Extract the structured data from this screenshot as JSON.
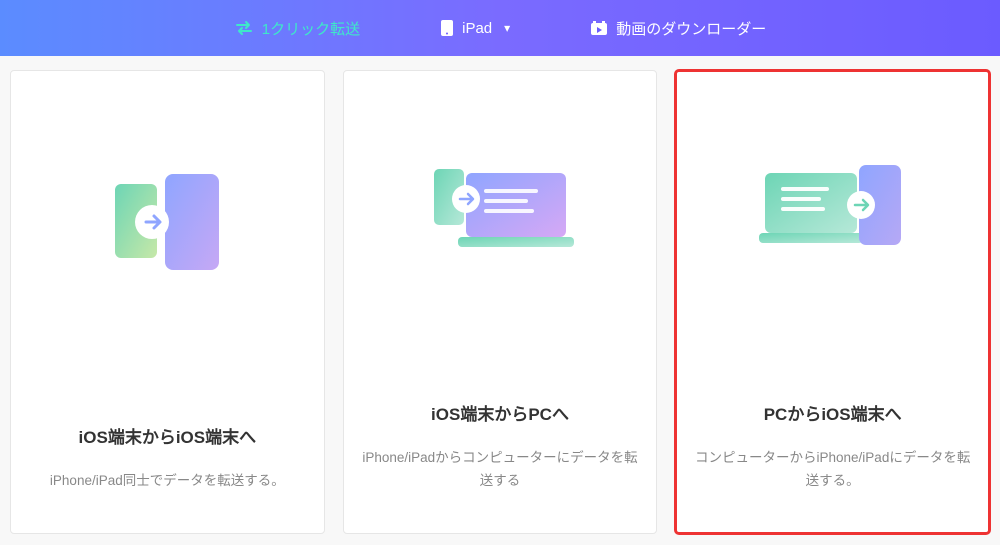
{
  "header": {
    "tabs": [
      {
        "label": "1クリック転送",
        "active": true
      },
      {
        "label": "iPad",
        "active": false,
        "dropdown": true
      },
      {
        "label": "動画のダウンローダー",
        "active": false
      }
    ]
  },
  "cards": [
    {
      "title": "iOS端末からiOS端末へ",
      "desc": "iPhone/iPad同士でデータを転送する。",
      "highlight": false,
      "illus": "ios-to-ios"
    },
    {
      "title": "iOS端末からPCへ",
      "desc": "iPhone/iPadからコンピューターにデータを転送する",
      "highlight": false,
      "illus": "ios-to-pc"
    },
    {
      "title": "PCからiOS端末へ",
      "desc": "コンピューターからiPhone/iPadにデータを転送する。",
      "highlight": true,
      "illus": "pc-to-ios"
    }
  ]
}
